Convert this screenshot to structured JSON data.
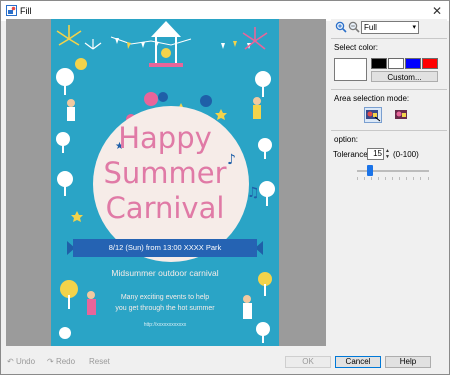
{
  "window": {
    "title": "Fill",
    "close_symbol": "✕"
  },
  "zoom": {
    "selected": "Full",
    "in_icon": "zoom-in-icon",
    "out_icon": "zoom-out-icon"
  },
  "color": {
    "heading": "Select color:",
    "current": "#ffffff",
    "swatches": [
      "#000000",
      "#ffffff",
      "#0000ff",
      "#ff0000"
    ],
    "custom_label": "Custom..."
  },
  "area_mode": {
    "heading": "Area selection mode:",
    "modes": [
      "area-select-mode-1-icon",
      "area-select-mode-2-icon"
    ]
  },
  "option": {
    "heading": "option:",
    "tolerance_label": "Tolerance:",
    "tolerance_value": "15",
    "tolerance_range": "(0-100)",
    "slider_level_fraction": 0.15
  },
  "poster": {
    "line1": "Happy",
    "line2": "Summer",
    "line3": "Carnival",
    "banner": "8/12 (Sun) from 13:00 XXXX Park",
    "subtitle": "Midsummer outdoor carnival",
    "body1": "Many exciting events to help",
    "body2": "you get through the hot summer",
    "url": "http://xxxxxxxxxxxx"
  },
  "footer": {
    "undo": "Undo",
    "redo": "Redo",
    "reset": "Reset",
    "ok": "OK",
    "cancel": "Cancel",
    "help": "Help"
  }
}
